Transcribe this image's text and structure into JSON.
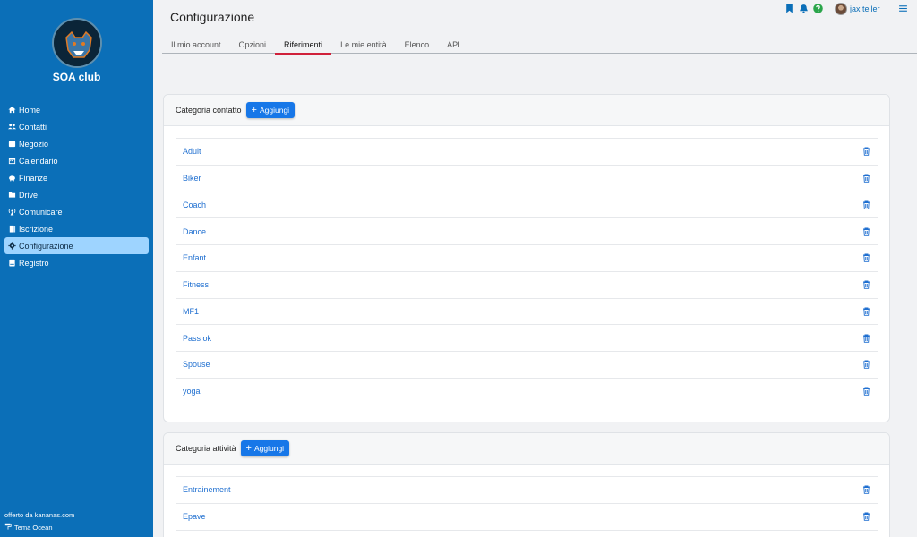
{
  "sidebar": {
    "club_name": "SOA club",
    "items": [
      {
        "label": "Home",
        "icon": "home-icon"
      },
      {
        "label": "Contatti",
        "icon": "users-icon"
      },
      {
        "label": "Negozio",
        "icon": "shop-icon"
      },
      {
        "label": "Calendario",
        "icon": "calendar-icon"
      },
      {
        "label": "Finanze",
        "icon": "piggy-bank-icon"
      },
      {
        "label": "Drive",
        "icon": "drive-icon"
      },
      {
        "label": "Comunicare",
        "icon": "broadcast-icon"
      },
      {
        "label": "Iscrizione",
        "icon": "registration-icon"
      },
      {
        "label": "Configurazione",
        "icon": "gear-icon",
        "active": true
      },
      {
        "label": "Registro",
        "icon": "book-icon"
      }
    ],
    "credit": "offerto da kananas.com",
    "theme": "Tema Ocean"
  },
  "header": {
    "title": "Configurazione",
    "user_name": "jax teller"
  },
  "tabs": [
    {
      "label": "Il mio account"
    },
    {
      "label": "Opzioni"
    },
    {
      "label": "Riferimenti",
      "active": true
    },
    {
      "label": "Le mie entità"
    },
    {
      "label": "Elenco"
    },
    {
      "label": "API"
    }
  ],
  "sections": [
    {
      "title": "Categoria contatto",
      "add_label": "Aggiungi",
      "items": [
        "Adult",
        "Biker",
        "Coach",
        "Dance",
        "Enfant",
        "Fitness",
        "MF1",
        "Pass ok",
        "Spouse",
        "yoga"
      ]
    },
    {
      "title": "Categoria attività",
      "add_label": "Aggiungi",
      "items": [
        "Entrainement",
        "Epave"
      ]
    }
  ],
  "colors": {
    "sidebar": "#0b6fb8",
    "active_nav": "#9ed4ff",
    "primary_button": "#1777e8",
    "link": "#1f6fd0",
    "tab_underline": "#d0203a"
  }
}
